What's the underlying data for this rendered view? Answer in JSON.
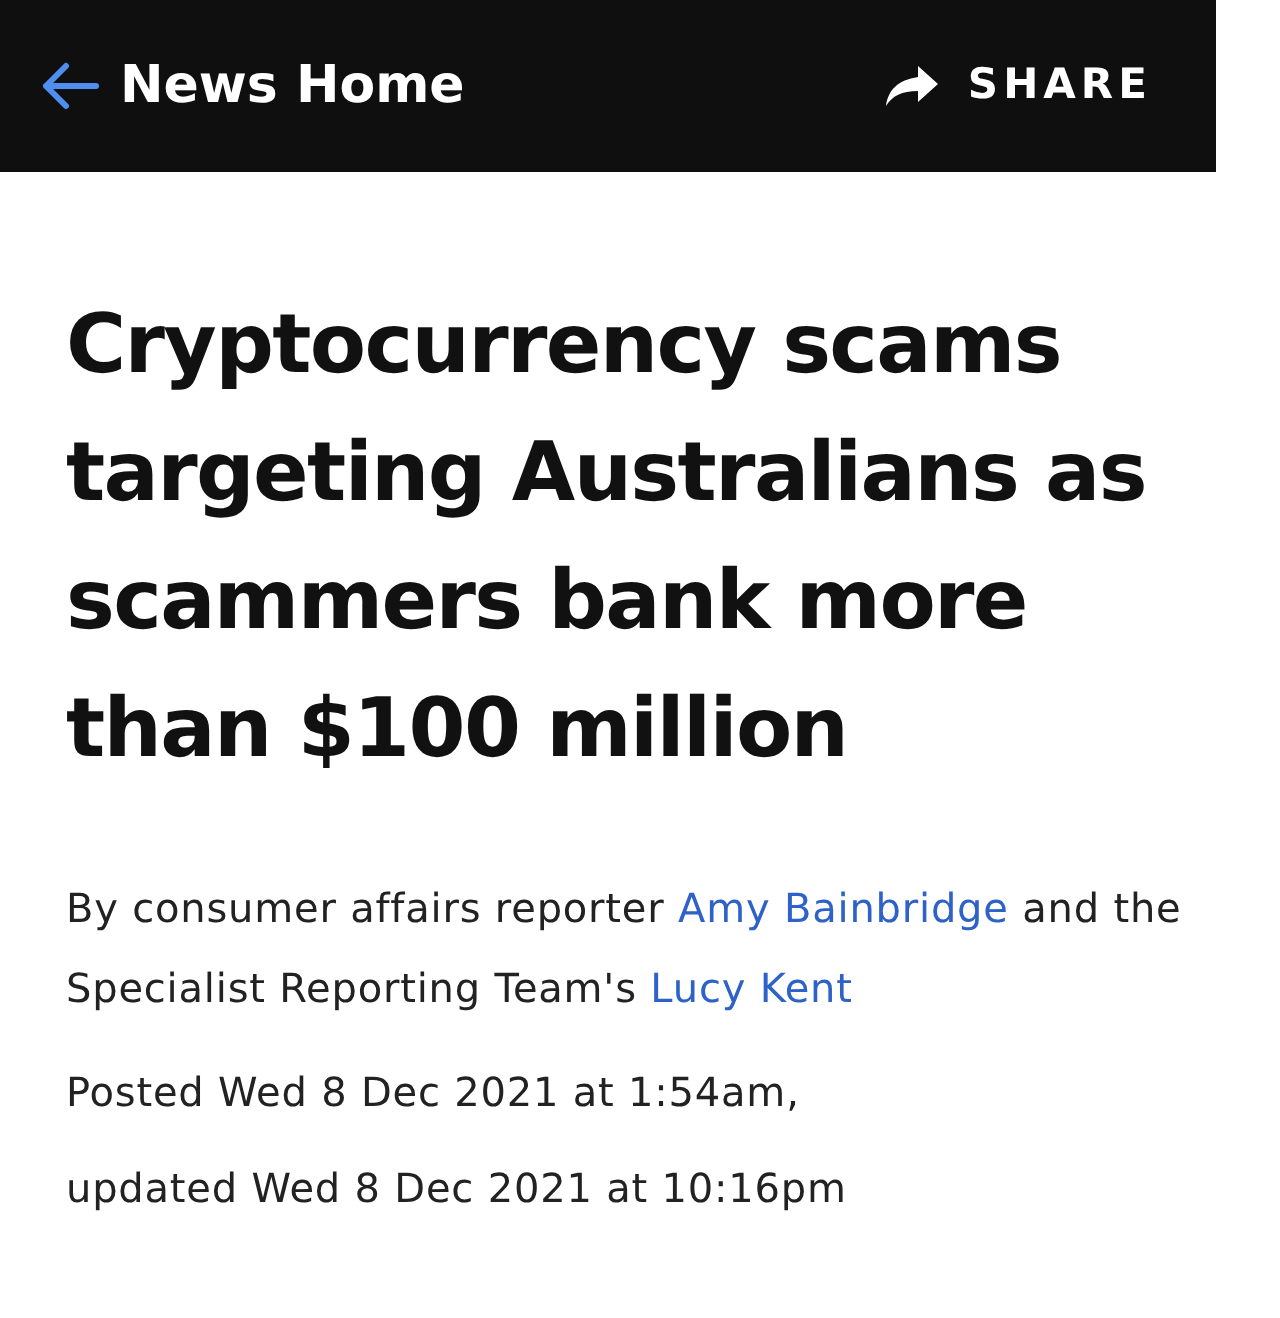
{
  "top_bar": {
    "back_label": "News Home",
    "share_label": "SHARE"
  },
  "headline": "Cryptocurrency scams targeting Australians as scammers bank more than $100 million",
  "byline": [
    {
      "kind": "text",
      "text": "By consumer affairs reporter "
    },
    {
      "kind": "link",
      "text": "Amy Bainbridge"
    },
    {
      "kind": "text",
      "text": " and the Specialist Reporting Team's "
    },
    {
      "kind": "link",
      "text": "Lucy Kent"
    }
  ],
  "posted": "Posted Wed 8 Dec 2021 at 1:54am,",
  "updated": "updated Wed 8 Dec 2021 at 10:16pm"
}
